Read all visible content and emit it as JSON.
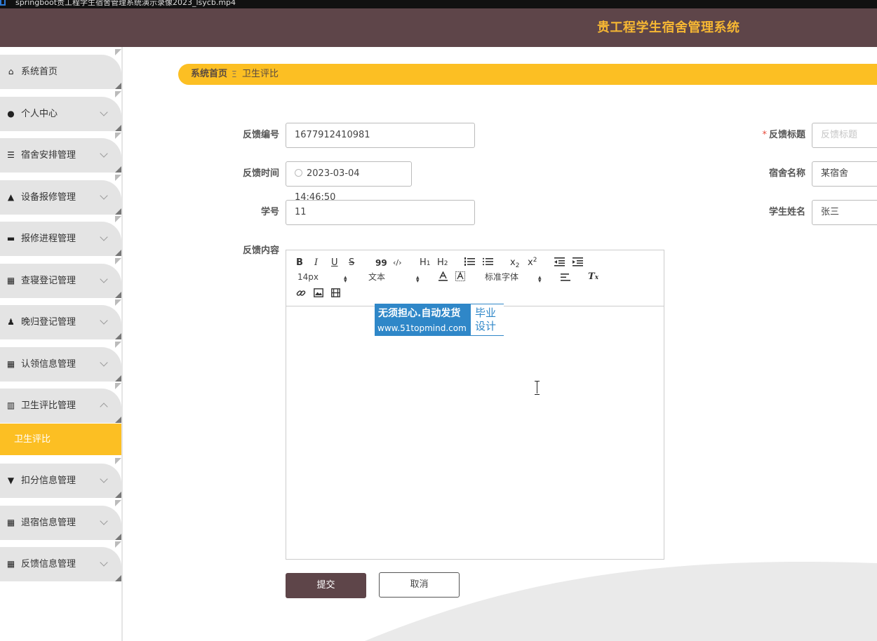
{
  "window": {
    "title": "springboot贵工程学生宿舍管理系统演示录像2023_lsycb.mp4"
  },
  "header": {
    "title": "贵工程学生宿舍管理系统"
  },
  "colors": {
    "header_bg": "#5e4549",
    "accent": "#fcbf23",
    "title": "#f6b733"
  },
  "sidebar": {
    "items": [
      {
        "label": "系统首页",
        "icon": "home-icon"
      },
      {
        "label": "个人中心",
        "icon": "user-icon"
      },
      {
        "label": "宿舍安排管理",
        "icon": "sliders-icon"
      },
      {
        "label": "设备报修管理",
        "icon": "user-icon"
      },
      {
        "label": "报修进程管理",
        "icon": "bed-icon"
      },
      {
        "label": "查寝登记管理",
        "icon": "grid-icon"
      },
      {
        "label": "晚归登记管理",
        "icon": "person-icon"
      },
      {
        "label": "认领信息管理",
        "icon": "grid-icon"
      },
      {
        "label": "卫生评比管理",
        "icon": "books-icon"
      },
      {
        "label": "扣分信息管理",
        "icon": "paint-icon"
      },
      {
        "label": "退宿信息管理",
        "icon": "grid-icon"
      },
      {
        "label": "反馈信息管理",
        "icon": "grid-icon"
      }
    ],
    "active_sub": "卫生评比"
  },
  "breadcrumb": {
    "home": "系统首页",
    "separator": "Ξ",
    "current": "卫生评比"
  },
  "form": {
    "feedback_no": {
      "label": "反馈编号",
      "value": "1677912410981"
    },
    "feedback_title": {
      "label": "反馈标题",
      "placeholder": "反馈标题",
      "required_mark": "*"
    },
    "feedback_time": {
      "label": "反馈时间",
      "value": "2023-03-04 14:46:50"
    },
    "dorm_name": {
      "label": "宿舍名称",
      "value": "某宿舍"
    },
    "student_no": {
      "label": "学号",
      "value": "11"
    },
    "student_name": {
      "label": "学生姓名",
      "value": "张三"
    },
    "content": {
      "label": "反馈内容"
    }
  },
  "editor": {
    "toolbar": {
      "bold": "B",
      "italic": "I",
      "underline": "U",
      "strike": "S",
      "quote": "99",
      "code": "‹/›",
      "h1": "H",
      "h1_sub": "1",
      "h2": "H",
      "h2_sub": "2",
      "sub": "x",
      "sub_mark": "2",
      "sup": "x",
      "sup_mark": "2",
      "size": "14px",
      "header": "文本",
      "font": "标准字体",
      "clear": "T"
    }
  },
  "watermark": {
    "line1": "无须担心.自动发货",
    "line2": "www.51topmind.com",
    "line3": "毕业设计"
  },
  "buttons": {
    "submit": "提交",
    "cancel": "取消"
  }
}
